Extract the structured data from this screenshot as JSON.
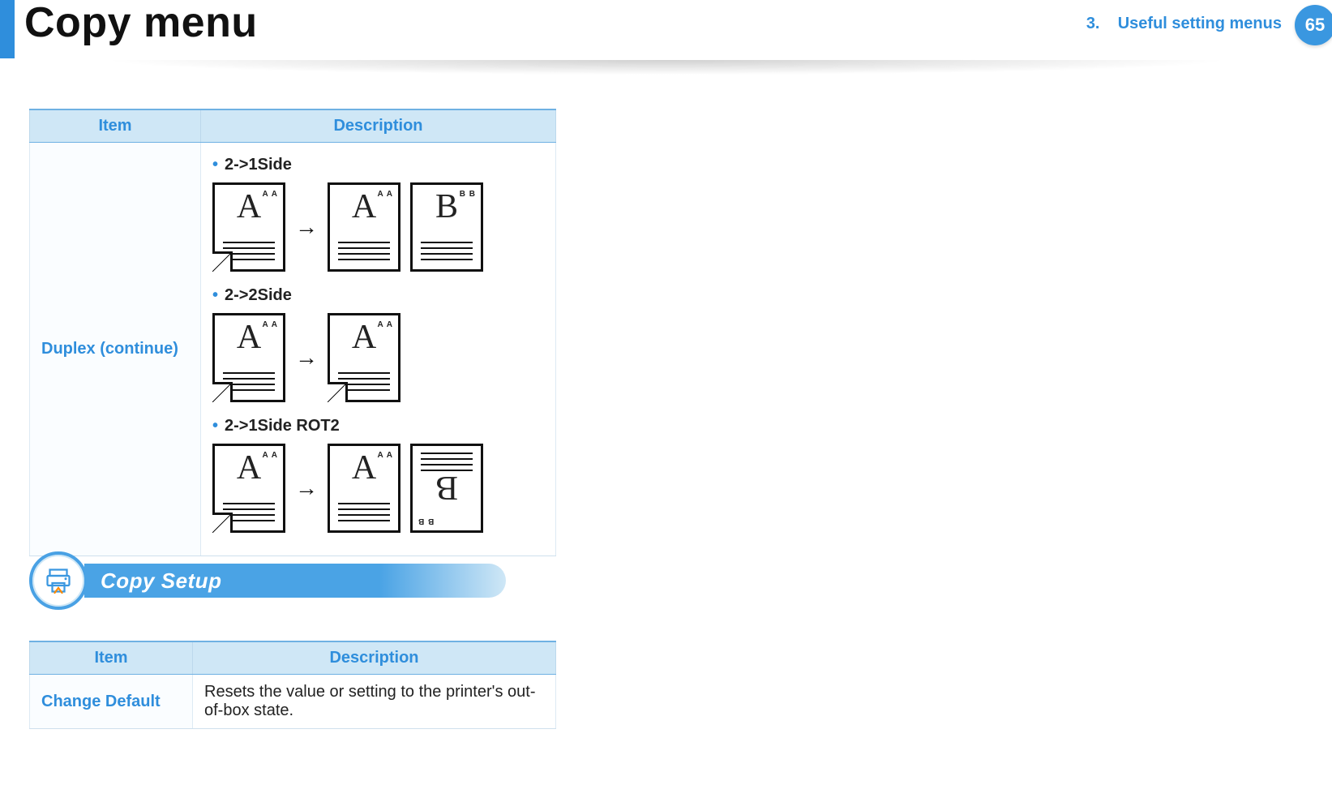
{
  "header": {
    "title": "Copy menu",
    "chapter_prefix": "3.",
    "chapter_title": "Useful setting menus",
    "page_number": "65"
  },
  "table1": {
    "col_item": "Item",
    "col_desc": "Description",
    "row_item": "Duplex (continue)",
    "options": {
      "a": "2->1Side",
      "b": "2->2Side",
      "c": "2->1Side ROT2"
    },
    "glyphs": {
      "A": "A",
      "B": "B",
      "AA": "A A",
      "BB": "B B",
      "arrow": "→"
    }
  },
  "section": {
    "title": "Copy Setup"
  },
  "table2": {
    "col_item": "Item",
    "col_desc": "Description",
    "row_item": "Change Default",
    "row_desc": "Resets the value or setting to the printer's out-of-box state."
  }
}
